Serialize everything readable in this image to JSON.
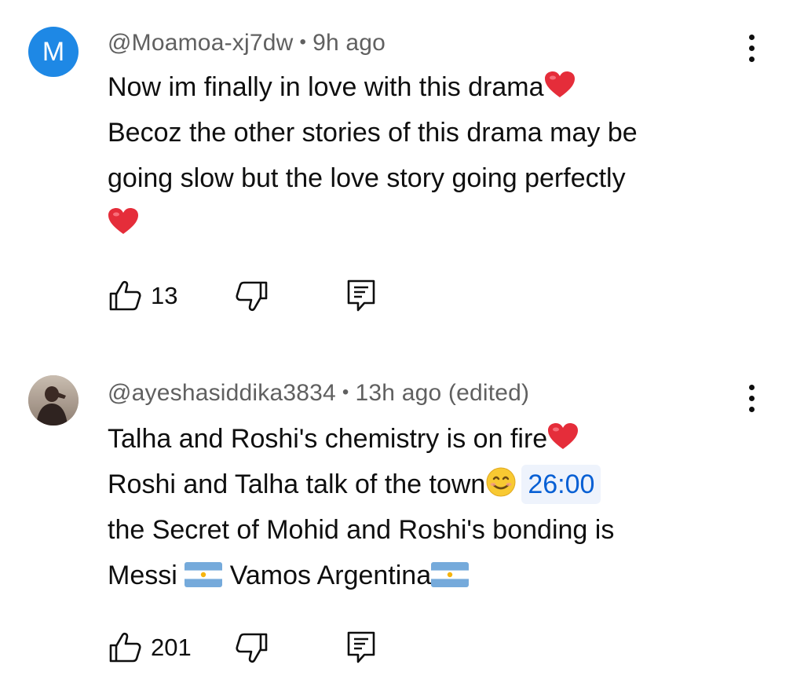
{
  "comments": [
    {
      "avatar_letter": "M",
      "avatar_color": "#1e88e5",
      "author": "@Moamoa-xj7dw",
      "separator": "•",
      "time": "9h ago",
      "lines": [
        "Now im finally in love with this drama",
        "Becoz the other stories of this drama may be",
        "going slow but the love story going perfectly"
      ],
      "likes": "13"
    },
    {
      "avatar_type": "photo",
      "author": "@ayeshasiddika3834",
      "separator": "•",
      "time": "13h ago (edited)",
      "lines": [
        "Talha and Roshi's chemistry is on fire",
        "Roshi and Talha talk of the town",
        "the Secret of Mohid and Roshi's bonding is",
        "Messi",
        "Vamos Argentina"
      ],
      "timestamp_link": "26:00",
      "likes": "201"
    }
  ],
  "icons": {
    "like": "thumbs-up-icon",
    "dislike": "thumbs-down-icon",
    "reply": "reply-comment-icon",
    "more": "more-vertical-icon",
    "heart": "red-heart-emoji",
    "smile": "smiling-face-emoji",
    "flag": "argentina-flag-emoji"
  },
  "colors": {
    "text": "#0f0f0f",
    "meta": "#606060",
    "link": "#065fd4",
    "link_bg": "#eef3fc",
    "heart": "#e52d3a"
  }
}
